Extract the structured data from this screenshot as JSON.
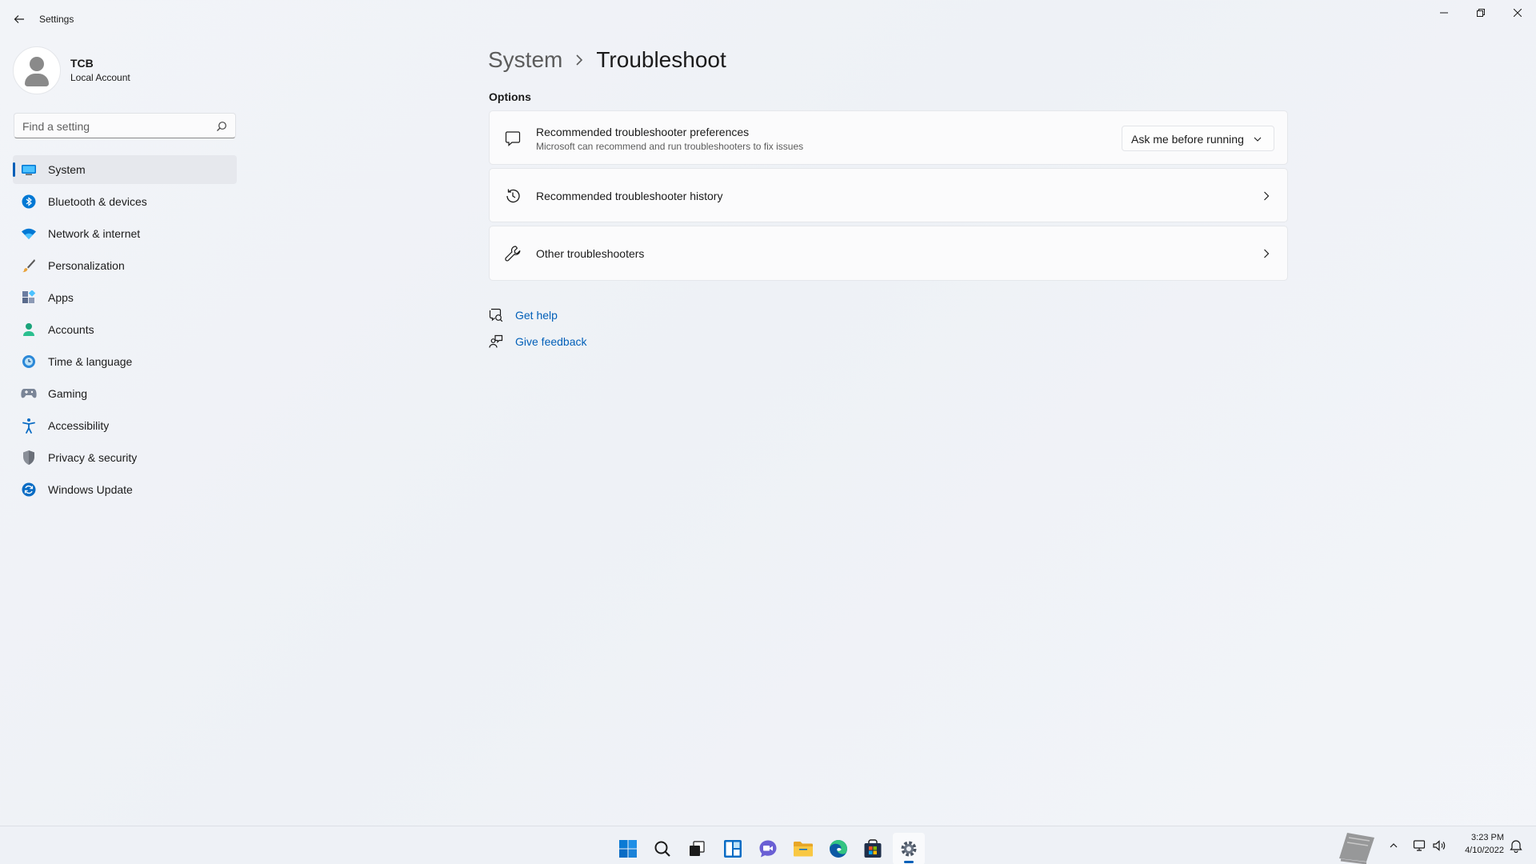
{
  "window": {
    "app_title": "Settings"
  },
  "profile": {
    "name": "TCB",
    "account_type": "Local Account"
  },
  "search": {
    "placeholder": "Find a setting"
  },
  "sidebar": {
    "items": [
      {
        "label": "System",
        "icon": "system-icon",
        "active": true
      },
      {
        "label": "Bluetooth & devices",
        "icon": "bluetooth-icon"
      },
      {
        "label": "Network & internet",
        "icon": "wifi-icon"
      },
      {
        "label": "Personalization",
        "icon": "brush-icon"
      },
      {
        "label": "Apps",
        "icon": "apps-icon"
      },
      {
        "label": "Accounts",
        "icon": "person-icon"
      },
      {
        "label": "Time & language",
        "icon": "globe-clock-icon"
      },
      {
        "label": "Gaming",
        "icon": "gamepad-icon"
      },
      {
        "label": "Accessibility",
        "icon": "accessibility-icon"
      },
      {
        "label": "Privacy & security",
        "icon": "shield-icon"
      },
      {
        "label": "Windows Update",
        "icon": "update-icon"
      }
    ]
  },
  "breadcrumb": {
    "parent": "System",
    "current": "Troubleshoot"
  },
  "options": {
    "section_title": "Options",
    "preferences": {
      "title": "Recommended troubleshooter preferences",
      "description": "Microsoft can recommend and run troubleshooters to fix issues",
      "dropdown_value": "Ask me before running"
    },
    "history": {
      "title": "Recommended troubleshooter history"
    },
    "other": {
      "title": "Other troubleshooters"
    }
  },
  "links": {
    "get_help": "Get help",
    "give_feedback": "Give feedback"
  },
  "taskbar": {
    "icons": [
      "start-icon",
      "search-icon",
      "task-view-icon",
      "widgets-icon",
      "chat-icon",
      "file-explorer-icon",
      "edge-icon",
      "store-icon",
      "settings-icon"
    ],
    "time": "3:23 PM",
    "date": "4/10/2022"
  },
  "colors": {
    "accent": "#005fb8",
    "background": "#f2f4f8",
    "card": "#fbfbfc"
  }
}
